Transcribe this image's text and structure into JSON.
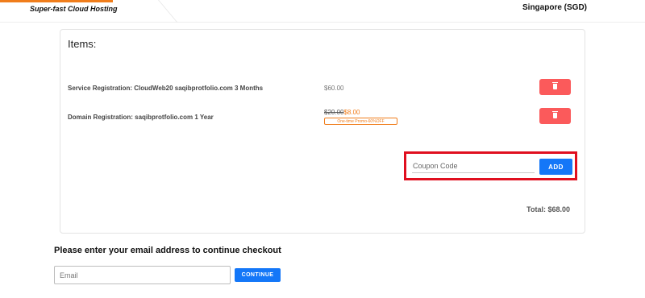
{
  "header": {
    "tagline": "Super-fast Cloud Hosting",
    "region": "Singapore (SGD)",
    "accent_color": "#f07d1b"
  },
  "cart": {
    "items_title": "Items:",
    "items": [
      {
        "description": "Service Registration: CloudWeb20 saqibprotfolio.com 3 Months",
        "price": "$60.00"
      },
      {
        "description": "Domain Registration: saqibprotfolio.com 1 Year",
        "original_price": "$20.00",
        "price": "$8.00",
        "promo_badge": "One-time Promo-60%OFF"
      }
    ],
    "delete_icon": "trash-icon",
    "coupon": {
      "placeholder": "Coupon Code",
      "value": "",
      "button_label": "ADD",
      "highlight_color": "#e00f1f"
    },
    "total_text": "Total: $68.00"
  },
  "checkout": {
    "prompt": "Please enter your email address to continue checkout",
    "email_placeholder": "Email",
    "email_value": "",
    "continue_label": "CONTINUE",
    "button_color": "#1477f8"
  }
}
